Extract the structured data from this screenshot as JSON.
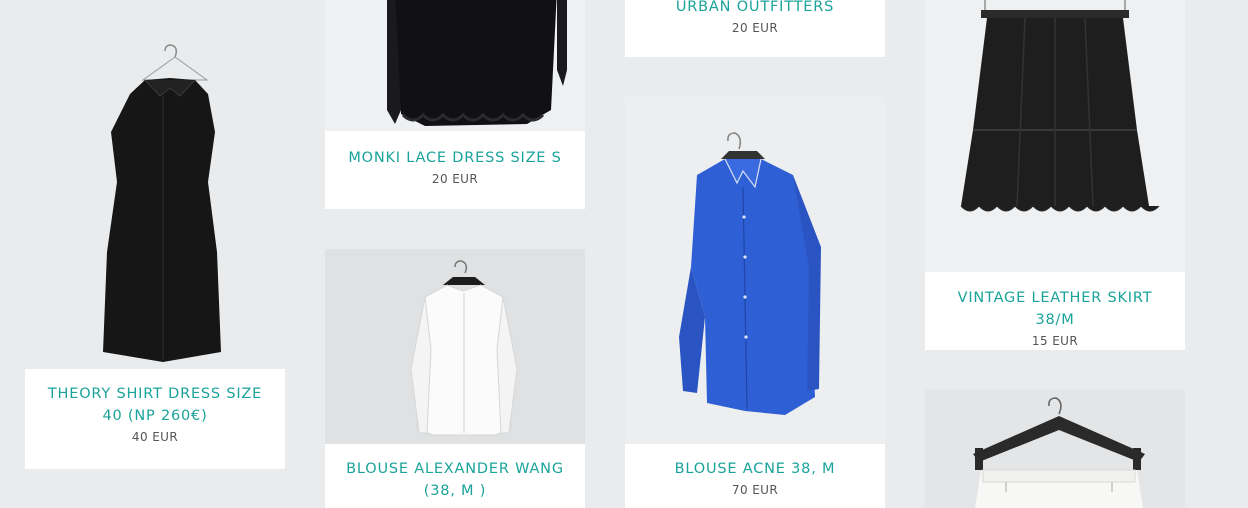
{
  "products": [
    {
      "title": "THEORY SHIRT DRESS SIZE 40 (NP 260€)",
      "price": "40 EUR"
    },
    {
      "title": "MONKI LACE DRESS SIZE S",
      "price": "20 EUR"
    },
    {
      "title": "BLOUSE ALEXANDER WANG (38, M )",
      "price": ""
    },
    {
      "title": "URBAN OUTFITTERS",
      "price": "20 EUR"
    },
    {
      "title": "BLOUSE ACNE 38, M",
      "price": "70 EUR"
    },
    {
      "title": "VINTAGE LEATHER SKIRT 38/M",
      "price": "15 EUR"
    },
    {
      "title": "",
      "price": ""
    }
  ],
  "colors": {
    "page_background": "#eaebed",
    "card_background": "#ffffff",
    "title_accent": "#1aa39a",
    "price_text": "#555555"
  }
}
